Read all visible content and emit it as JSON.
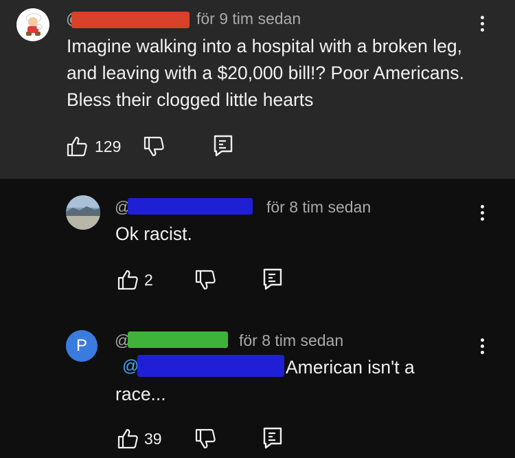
{
  "colors": {
    "top_background": "#282828",
    "page_background": "#0f0f0f",
    "text_primary": "#f1f1f1",
    "text_secondary": "#aaaaaa",
    "redaction_red": "#d9412a",
    "redaction_blue": "#1f1fd6",
    "redaction_green": "#3fb23a",
    "avatar_p_blue": "#3a7be0"
  },
  "comments": [
    {
      "handle_prefix": "@",
      "redaction_color": "red",
      "time": "för 9 tim sedan",
      "text": "Imagine walking into a hospital with a broken leg, and leaving with a $20,000 bill!? Poor Americans. Bless their clogged little hearts",
      "likes": "129",
      "avatar_icon": "mario-avatar-icon"
    },
    {
      "handle_prefix": "@",
      "redaction_color": "blue",
      "time": "för 8 tim sedan",
      "text": "Ok racist.",
      "likes": "2",
      "avatar_icon": "landscape-avatar-icon"
    },
    {
      "handle_prefix": "@",
      "redaction_color": "green",
      "time": "för 8 tim sedan",
      "mention": "@",
      "text": "American isn't a race...",
      "likes": "39",
      "avatar_letter": "P"
    }
  ]
}
